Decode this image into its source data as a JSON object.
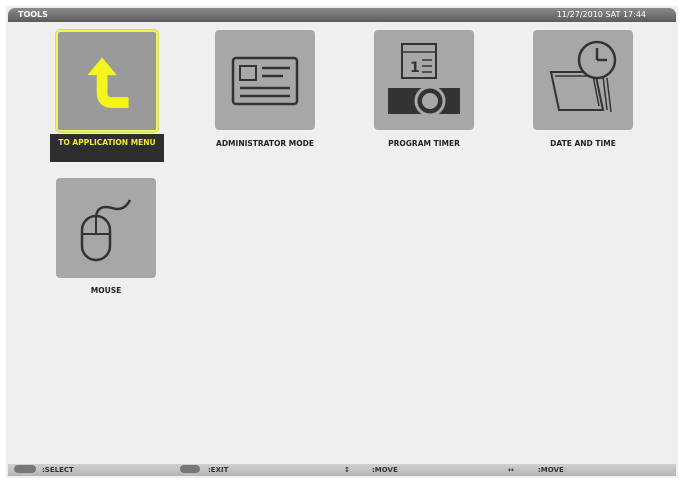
{
  "header": {
    "title": "TOOLS",
    "datetime": "11/27/2010 SAT 17:44"
  },
  "tiles": [
    {
      "label": "TO APPLICATION MENU",
      "icon": "back-arrow-icon"
    },
    {
      "label": "ADMINISTRATOR MODE",
      "icon": "id-card-icon"
    },
    {
      "label": "PROGRAM TIMER",
      "icon": "program-timer-icon"
    },
    {
      "label": "DATE AND TIME",
      "icon": "clock-calendar-icon"
    },
    {
      "label": "MOUSE",
      "icon": "mouse-icon"
    }
  ],
  "selected_tile": "TO APPLICATION MENU",
  "footer": {
    "select": ":SELECT",
    "exit": ":EXIT",
    "move_v_arrow": "↕",
    "move_v": ":MOVE",
    "move_h_arrow": "↔",
    "move_h": ":MOVE"
  },
  "colors": {
    "highlight": "#f2f25a",
    "selected_label_bg": "#2e2e2e",
    "selected_label_text": "#f5e930"
  }
}
